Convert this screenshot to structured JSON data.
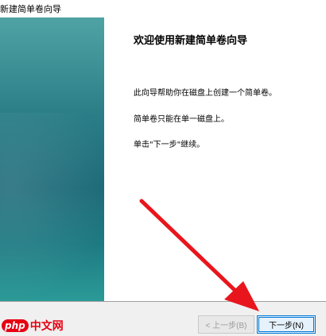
{
  "window": {
    "title": "新建简单卷向导"
  },
  "wizard": {
    "heading": "欢迎使用新建简单卷向导",
    "paragraphs": [
      "此向导帮助你在磁盘上创建一个简单卷。",
      "简单卷只能在单一磁盘上。",
      "单击\"下一步\"继续。"
    ]
  },
  "buttons": {
    "back_label": "< 上一步(B)",
    "next_label": "下一步(N)"
  },
  "watermark": {
    "badge": "php",
    "text": "中文网"
  },
  "annotation": {
    "arrow_color": "#e8161c",
    "icon": "red-arrow-icon"
  },
  "colors": {
    "banner": "#1d6a78",
    "focus": "#0078d7"
  }
}
